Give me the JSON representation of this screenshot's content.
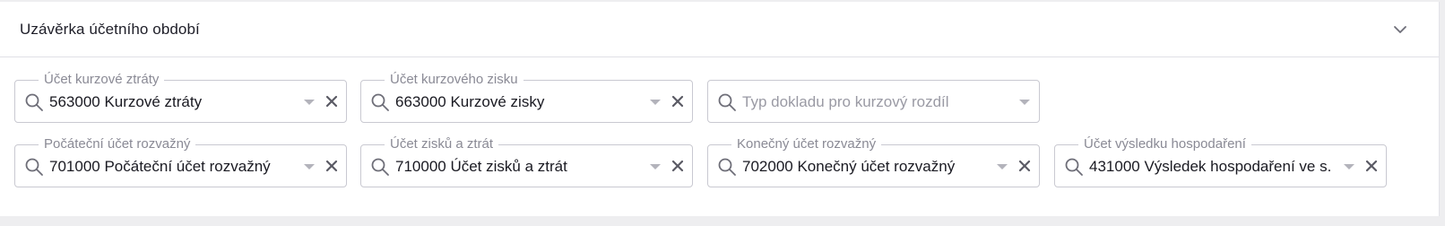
{
  "section": {
    "title": "Uzávěrka účetního období"
  },
  "fields": [
    {
      "label": "Účet kurzové ztráty",
      "value": "563000 Kurzové ztráty",
      "placeholder": ""
    },
    {
      "label": "Účet kurzového zisku",
      "value": "663000 Kurzové zisky",
      "placeholder": ""
    },
    {
      "label": "",
      "value": "",
      "placeholder": "Typ dokladu pro kurzový rozdíl"
    },
    {
      "label": "Počáteční účet rozvažný",
      "value": "701000 Počáteční účet rozvažný",
      "placeholder": ""
    },
    {
      "label": "Účet zisků a ztrát",
      "value": "710000 Účet zisků a ztrát",
      "placeholder": ""
    },
    {
      "label": "Konečný účet rozvažný",
      "value": "702000 Konečný účet rozvažný",
      "placeholder": ""
    },
    {
      "label": "Účet výsledku hospodaření",
      "value": "431000 Výsledek hospodaření ve s...",
      "placeholder": ""
    }
  ],
  "icons": {
    "search": "search-icon",
    "dropdown": "chevron-down-icon",
    "clear": "close-icon",
    "collapse": "chevron-down-icon"
  },
  "colors": {
    "border": "#c9c9d1",
    "label": "#8a8a95",
    "text": "#1a1a22",
    "icon": "#6e6e78"
  }
}
